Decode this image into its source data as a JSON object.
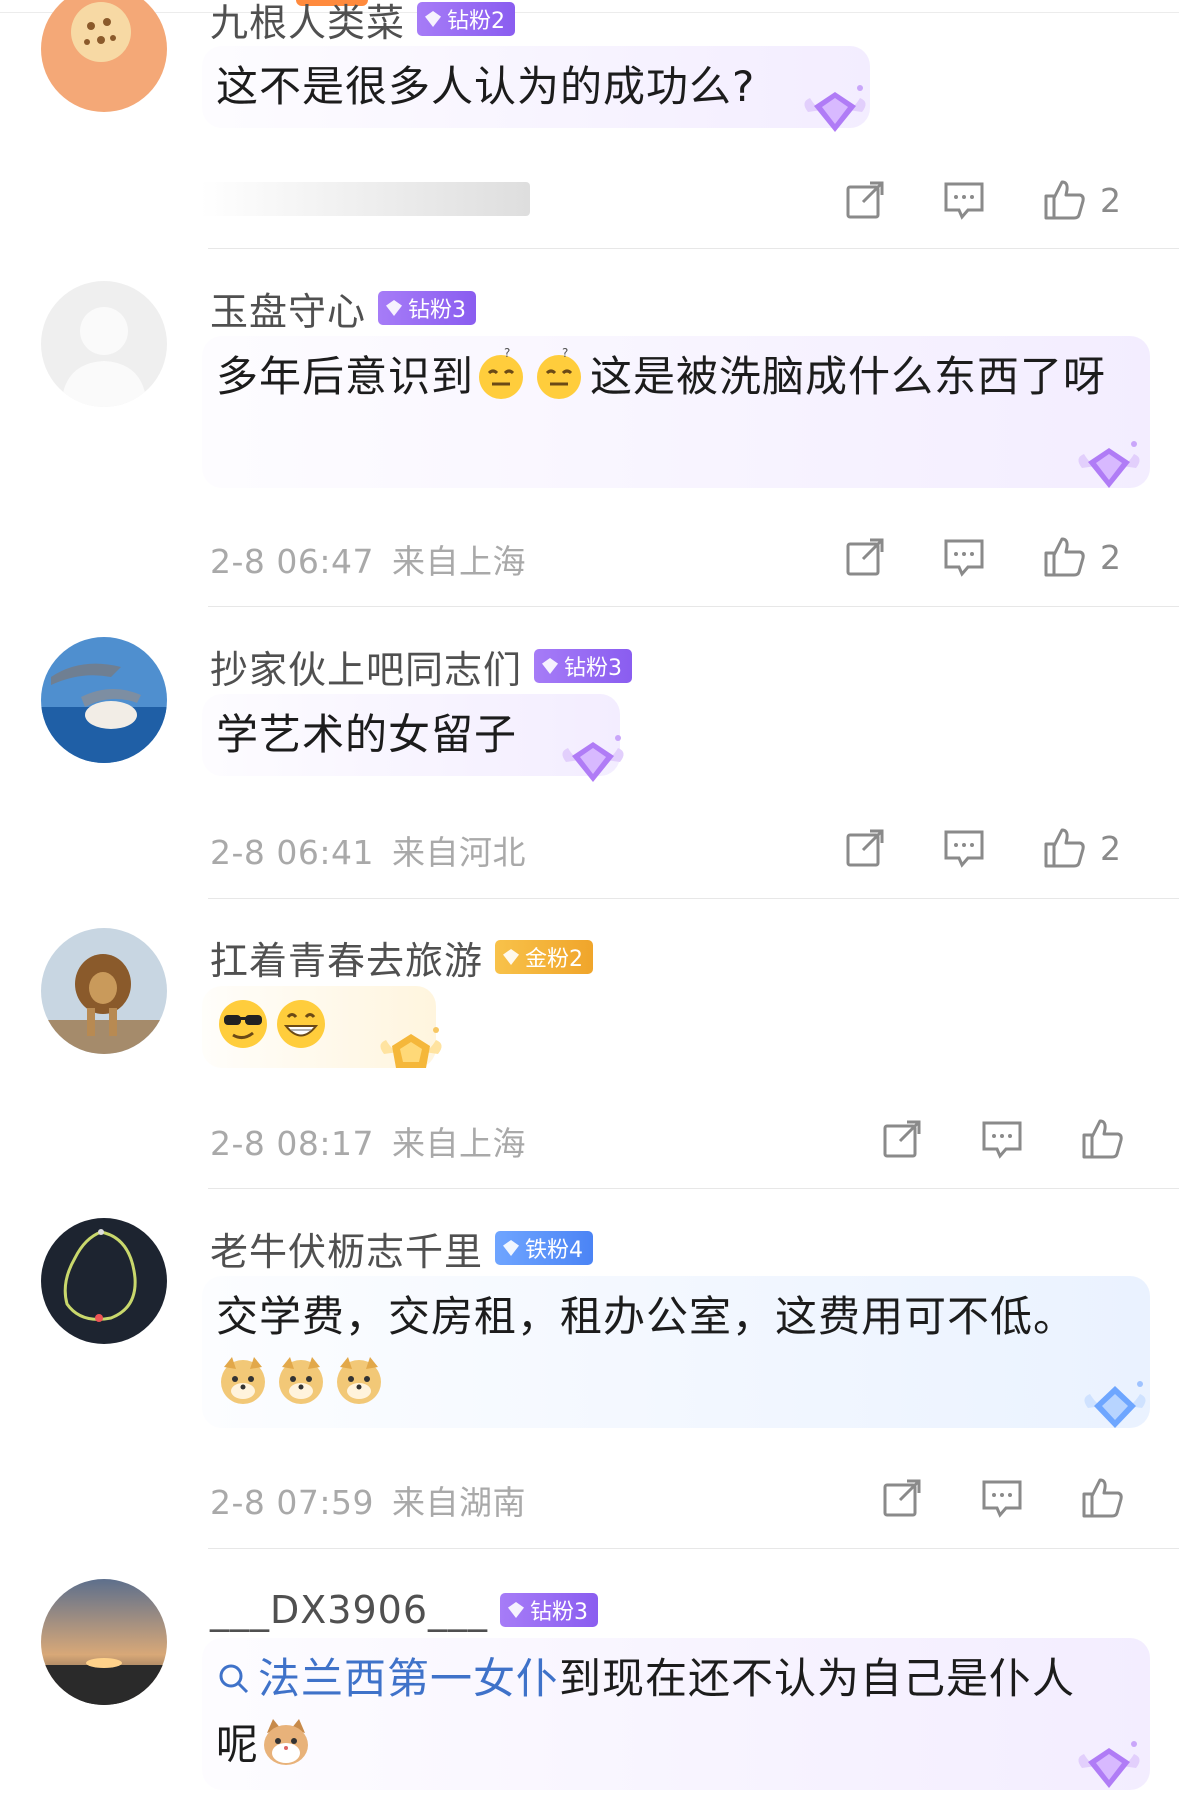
{
  "comments": [
    {
      "username": "九根人类菜",
      "badge": "钻粉2",
      "badge_color": "#9a6cf3",
      "text": "这不是很多人认为的成功么?",
      "time": "",
      "location": "",
      "likes": "2"
    },
    {
      "username": "玉盘守心",
      "badge": "钻粉3",
      "badge_color": "#9a6cf3",
      "text": "多年后意识到",
      "text_after": "这是被洗脑成什么东西了呀",
      "emojis": [
        "dizzy-face-emoji",
        "dizzy-face-emoji"
      ],
      "time": "2-8 06:47",
      "location": "来自上海",
      "likes": "2"
    },
    {
      "username": "抄家伙上吧同志们",
      "badge": "钻粉3",
      "badge_color": "#9a6cf3",
      "text": "学艺术的女留子",
      "time": "2-8 06:41",
      "location": "来自河北",
      "likes": "2"
    },
    {
      "username": "扛着青春去旅游",
      "badge": "金粉2",
      "badge_color": "#f3b33a",
      "emojis": [
        "sunglasses-emoji",
        "grin-emoji"
      ],
      "time": "2-8 08:17",
      "location": "来自上海",
      "likes": ""
    },
    {
      "username": "老牛伏枥志千里",
      "badge": "铁粉4",
      "badge_color": "#5a90f7",
      "text": "交学费，交房租，租办公室，这费用可不低。",
      "emojis": [
        "doge-emoji",
        "doge-emoji",
        "doge-emoji"
      ],
      "time": "2-8 07:59",
      "location": "来自湖南",
      "likes": ""
    },
    {
      "username": "___DX3906___",
      "badge": "钻粉3",
      "badge_color": "#9a6cf3",
      "topic": "法兰西第一女仆",
      "text": "到现在还不认为自己是仆人",
      "text_after": "呢",
      "emojis": [
        "cat-emoji"
      ]
    }
  ],
  "icons": {
    "repost": "share-icon",
    "comment": "comment-icon",
    "like": "thumbs-up-icon"
  }
}
